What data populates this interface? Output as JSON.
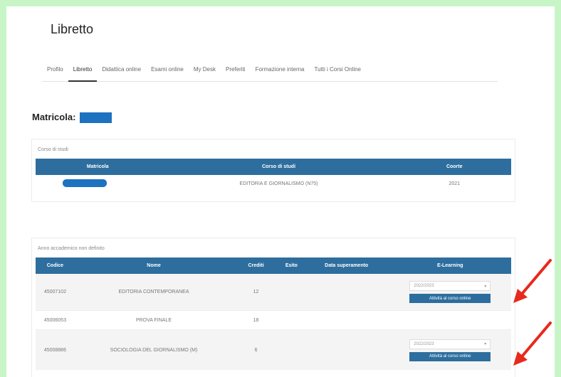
{
  "page": {
    "title": "Libretto"
  },
  "tabs": [
    {
      "label": "Profilo"
    },
    {
      "label": "Libretto"
    },
    {
      "label": "Didattica online"
    },
    {
      "label": "Esami online"
    },
    {
      "label": "My Desk"
    },
    {
      "label": "Preferiti"
    },
    {
      "label": "Formazione interna"
    },
    {
      "label": "Tutti i Corsi Online"
    }
  ],
  "active_tab": "Libretto",
  "matricola": {
    "label": "Matricola:"
  },
  "corso": {
    "title": "Corso di studi",
    "headers": [
      "Matricola",
      "Corso di studi",
      "Coorte"
    ],
    "row": {
      "corso": "EDITORIA E GIORNALISMO (N75)",
      "coorte": "2021"
    }
  },
  "anno": {
    "title": "Anno accademico non definito",
    "headers": [
      "Codice",
      "Nome",
      "Crediti",
      "Esito",
      "Data superamento",
      "E-Learning"
    ],
    "rows": [
      {
        "codice": "45007102",
        "nome": "EDITORIA CONTEMPORANEA",
        "crediti": "12",
        "select": "2022/2023",
        "button": "Attività al corso online"
      },
      {
        "codice": "45006053",
        "nome": "PROVA FINALE",
        "crediti": "18"
      },
      {
        "codice": "45008886",
        "nome": "SOCIOLOGIA DEL GIORNALISMO (M)",
        "crediti": "6",
        "select": "2022/2023",
        "button": "Attività al corso online"
      }
    ]
  },
  "colors": {
    "header": "#2d6e9e",
    "redacted": "#1e72c0",
    "arrow": "#e8291c",
    "background": "#c8f5c8"
  }
}
